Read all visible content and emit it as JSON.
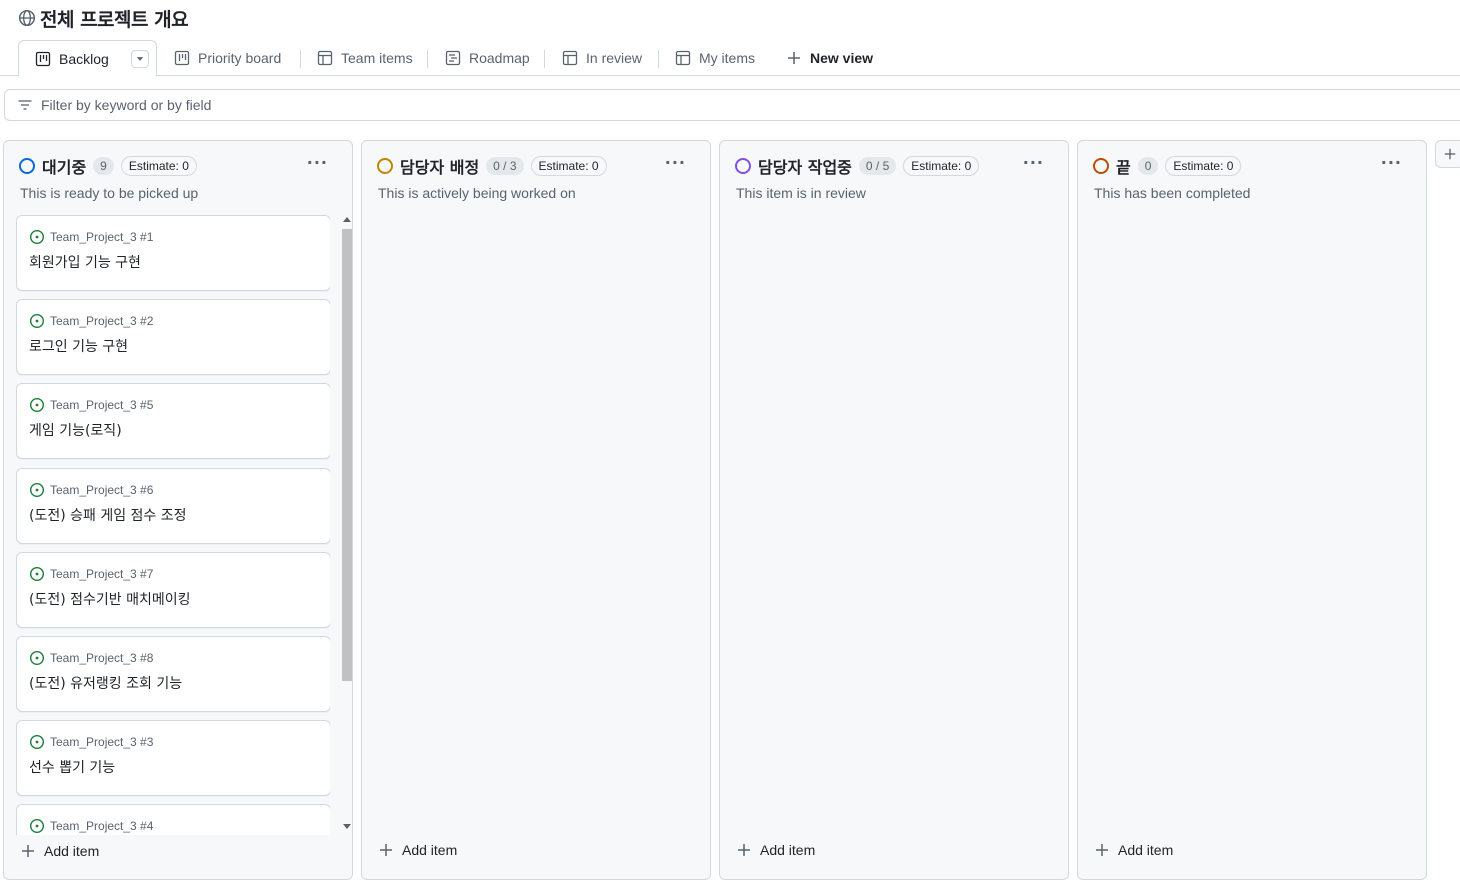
{
  "page": {
    "title": "전체 프로젝트 개요"
  },
  "tabs": [
    {
      "label": "Backlog",
      "icon": "board-icon"
    },
    {
      "label": "Priority board",
      "icon": "board-icon"
    },
    {
      "label": "Team items",
      "icon": "table-icon"
    },
    {
      "label": "Roadmap",
      "icon": "roadmap-icon"
    },
    {
      "label": "In review",
      "icon": "table-icon"
    },
    {
      "label": "My items",
      "icon": "table-icon"
    },
    {
      "label": "New view",
      "icon": "plus-icon"
    }
  ],
  "filter": {
    "placeholder": "Filter by keyword or by field"
  },
  "columns": [
    {
      "title": "대기중",
      "count": "9",
      "estimate": "Estimate: 0",
      "description": "This is ready to be picked up",
      "color": "#0969da",
      "add_label": "Add item",
      "cards": [
        {
          "repo": "Team_Project_3 #1",
          "title": "회원가입 기능 구현"
        },
        {
          "repo": "Team_Project_3 #2",
          "title": "로그인 기능 구현"
        },
        {
          "repo": "Team_Project_3 #5",
          "title": "게임 기능(로직)"
        },
        {
          "repo": "Team_Project_3 #6",
          "title": "(도전) 승패 게임 점수 조정"
        },
        {
          "repo": "Team_Project_3 #7",
          "title": "(도전) 점수기반 매치메이킹"
        },
        {
          "repo": "Team_Project_3 #8",
          "title": "(도전) 유저랭킹 조회 기능"
        },
        {
          "repo": "Team_Project_3 #3",
          "title": "선수 뽑기 기능"
        },
        {
          "repo": "Team_Project_3 #4",
          "title": ""
        }
      ]
    },
    {
      "title": "담당자 배정",
      "count": "0 / 3",
      "estimate": "Estimate: 0",
      "description": "This is actively being worked on",
      "color": "#bf8700",
      "add_label": "Add item"
    },
    {
      "title": "담당자 작업중",
      "count": "0 / 5",
      "estimate": "Estimate: 0",
      "description": "This item is in review",
      "color": "#8250df",
      "add_label": "Add item"
    },
    {
      "title": "끝",
      "count": "0",
      "estimate": "Estimate: 0",
      "description": "This has been completed",
      "color": "#bc4c00",
      "add_label": "Add item"
    }
  ],
  "colors": {
    "open_issue": "#1a7f37",
    "border": "#d1d9e0",
    "muted": "#59636e"
  }
}
